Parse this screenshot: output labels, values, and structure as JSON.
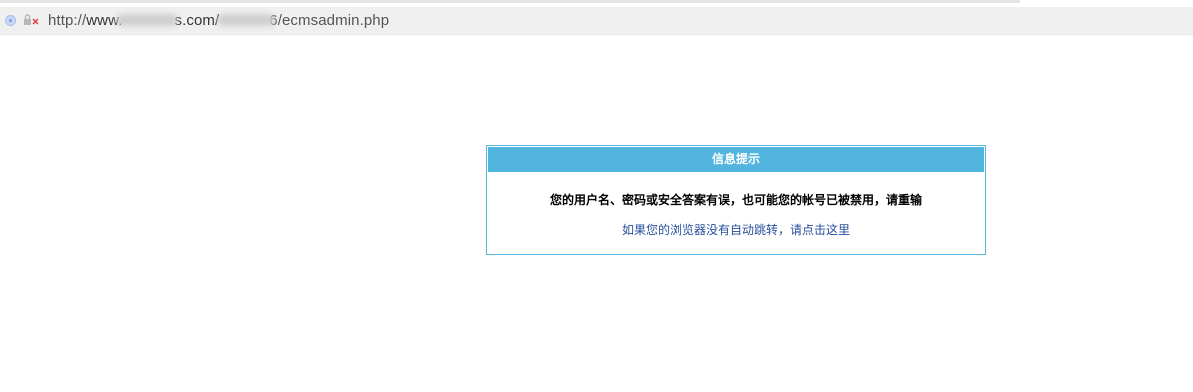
{
  "address_bar": {
    "url_scheme": "http://",
    "url_host_start": "www.",
    "url_host_end": "s.com/",
    "url_path_end": "6/ecmsadmin.php"
  },
  "dialog": {
    "title": "信息提示",
    "message": "您的用户名、密码或安全答案有误，也可能您的帐号已被禁用，请重输",
    "redirect_link": "如果您的浏览器没有自动跳转，请点击这里"
  }
}
